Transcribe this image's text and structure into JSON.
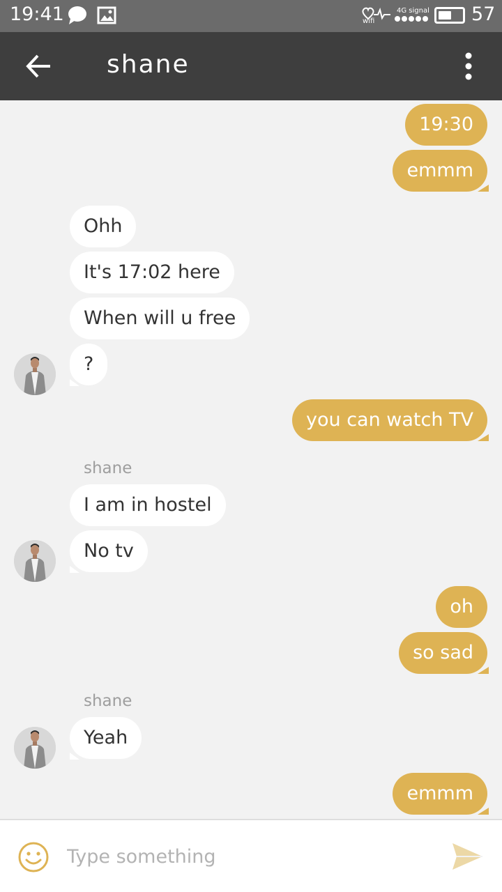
{
  "status_bar": {
    "time": "19:41",
    "wifi_label": "wifi",
    "network_label": "4G signal",
    "battery_percent": "57",
    "icons": [
      "chat-bubble-icon",
      "image-icon",
      "heart-pulse-icon",
      "signal-dots-icon",
      "battery-icon"
    ]
  },
  "header": {
    "title": "shane",
    "back_icon": "arrow-left-icon",
    "menu_icon": "more-vertical-icon"
  },
  "colors": {
    "outgoing_bubble": "#deb354",
    "incoming_bubble": "#ffffff",
    "app_bar": "#3e3e3e",
    "status_bar": "#6b6b6b",
    "background": "#f2f2f2"
  },
  "messages": [
    {
      "text": "19:30",
      "direction": "out"
    },
    {
      "text": "emmm",
      "direction": "out"
    },
    {
      "text": "Ohh",
      "direction": "in"
    },
    {
      "text": "It's 17:02 here",
      "direction": "in"
    },
    {
      "text": "When will u free",
      "direction": "in"
    },
    {
      "text": "?",
      "direction": "in"
    },
    {
      "text": "you can watch TV",
      "direction": "out"
    },
    {
      "sender": "shane"
    },
    {
      "text": "I am in hostel",
      "direction": "in"
    },
    {
      "text": "No tv",
      "direction": "in"
    },
    {
      "text": "oh",
      "direction": "out"
    },
    {
      "text": "so sad",
      "direction": "out"
    },
    {
      "sender": "shane"
    },
    {
      "text": "Yeah",
      "direction": "in"
    },
    {
      "text": "emmm",
      "direction": "out"
    }
  ],
  "input": {
    "placeholder": "Type something",
    "value": "",
    "emoji_icon": "smiley-icon",
    "send_icon": "send-icon"
  }
}
